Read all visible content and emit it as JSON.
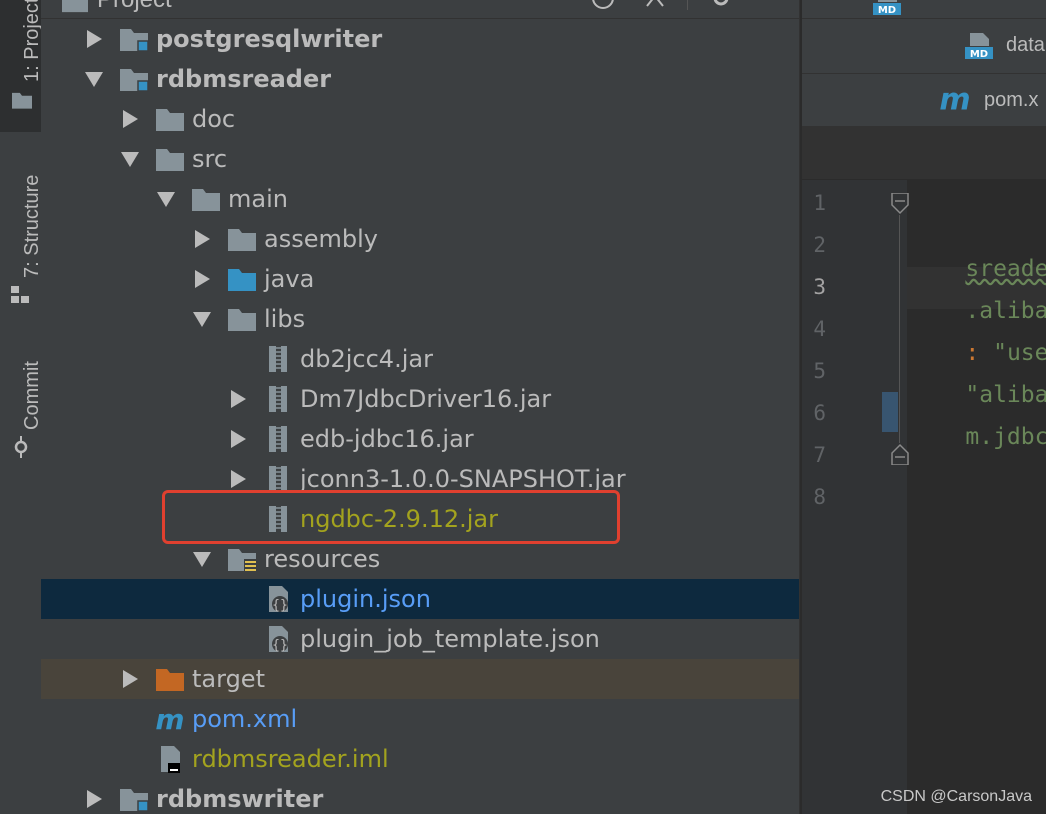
{
  "toolstrip": {
    "project_label": "1: Project",
    "structure_label": "7: Structure",
    "commit_label": "Commit"
  },
  "panel": {
    "title": "Project"
  },
  "tree": {
    "postgresqlwriter": "postgresqlwriter",
    "rdbmsreader": "rdbmsreader",
    "doc": "doc",
    "src": "src",
    "main": "main",
    "assembly": "assembly",
    "java": "java",
    "libs": "libs",
    "db2jcc4": "db2jcc4.jar",
    "dm7": "Dm7JdbcDriver16.jar",
    "edb": "edb-jdbc16.jar",
    "jconn3": "jconn3-1.0.0-SNAPSHOT.jar",
    "ngdbc": "ngdbc-2.9.12.jar",
    "resources": "resources",
    "plugin_json": "plugin.json",
    "plugin_job_template": "plugin_job_template.json",
    "target": "target",
    "pom": "pom.xml",
    "iml": "rdbmsreader.iml",
    "rdbmswriter": "rdbmswriter"
  },
  "editor": {
    "tab_md": "data",
    "tab_pom": "pom.x",
    "line_numbers": [
      "1",
      "2",
      "3",
      "4",
      "5",
      "6",
      "7",
      "8"
    ],
    "lines": {
      "l2_a": "sreader\"",
      "l2_b": ",",
      "l3": ".alibaba.",
      "l4_a": ":",
      "l4_b": " \"useSce",
      "l5": "\"alibaba\"",
      "l6": "m.jdbc.dr"
    }
  },
  "watermark": "CSDN @CarsonJava",
  "colors": {
    "panel_bg": "#3c3f41",
    "editor_bg": "#2b2b2b",
    "selection": "#0d293e",
    "excluded_bg": "#49443b",
    "folder": "#87939a",
    "source_folder": "#3592c4",
    "excluded_folder": "#c36723",
    "olive_text": "#a3a31e",
    "blue_text": "#589df6",
    "string_green": "#6a8759",
    "keyword_orange": "#cc7832",
    "highlight_red": "#e0402f"
  }
}
